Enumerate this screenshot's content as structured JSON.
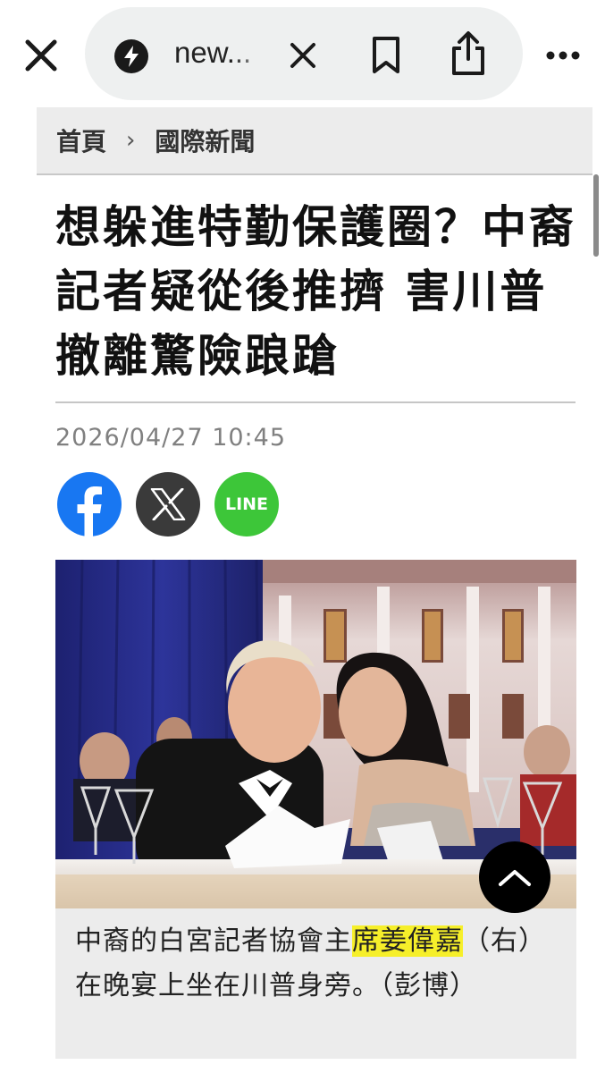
{
  "browser": {
    "url_text": "new...",
    "close_label": "close-tab",
    "icons": [
      "close-icon",
      "bolt-icon",
      "clear-icon",
      "bookmark-icon",
      "share-icon",
      "more-icon"
    ]
  },
  "breadcrumb": {
    "home": "首頁",
    "separator": "›",
    "section": "國際新聞"
  },
  "article": {
    "headline": "想躲進特勤保護圈？中裔記者疑從後推擠 害川普撤離驚險踉蹌",
    "date": "2026/04/27 10:45",
    "share": {
      "facebook_icon": "facebook-icon",
      "x_icon": "x-icon",
      "line_label": "LINE"
    },
    "photo": {
      "description_icon": "photo-icon"
    },
    "caption": {
      "part1": "中裔的白宮記者協會主",
      "highlight": "席姜偉嘉",
      "part2": "（右）在晚宴上坐在川普身旁。（彭博）"
    }
  },
  "colors": {
    "facebook": "#1877f2",
    "x": "#3a3a3a",
    "line": "#3dc639",
    "highlight": "#f6ef2a",
    "caption_bg": "#ececec"
  }
}
